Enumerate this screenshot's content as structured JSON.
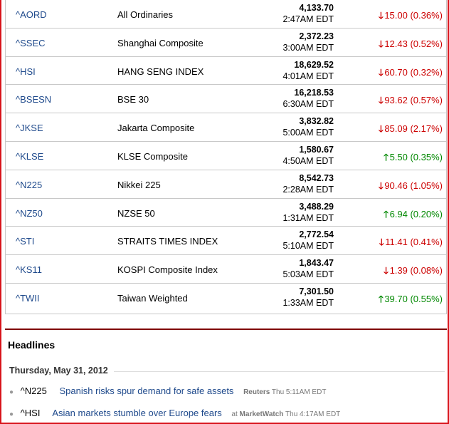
{
  "indices": [
    {
      "symbol": "^AORD",
      "name": "All Ordinaries",
      "price": "4,133.70",
      "time": "2:47AM EDT",
      "direction": "down",
      "change": "15.00 (0.36%)"
    },
    {
      "symbol": "^SSEC",
      "name": "Shanghai Composite",
      "price": "2,372.23",
      "time": "3:00AM EDT",
      "direction": "down",
      "change": "12.43 (0.52%)"
    },
    {
      "symbol": "^HSI",
      "name": "HANG SENG INDEX",
      "price": "18,629.52",
      "time": "4:01AM EDT",
      "direction": "down",
      "change": "60.70 (0.32%)"
    },
    {
      "symbol": "^BSESN",
      "name": "BSE 30",
      "price": "16,218.53",
      "time": "6:30AM EDT",
      "direction": "down",
      "change": "93.62 (0.57%)"
    },
    {
      "symbol": "^JKSE",
      "name": "Jakarta Composite",
      "price": "3,832.82",
      "time": "5:00AM EDT",
      "direction": "down",
      "change": "85.09 (2.17%)"
    },
    {
      "symbol": "^KLSE",
      "name": "KLSE Composite",
      "price": "1,580.67",
      "time": "4:50AM EDT",
      "direction": "up",
      "change": "5.50 (0.35%)"
    },
    {
      "symbol": "^N225",
      "name": "Nikkei 225",
      "price": "8,542.73",
      "time": "2:28AM EDT",
      "direction": "down",
      "change": "90.46 (1.05%)"
    },
    {
      "symbol": "^NZ50",
      "name": "NZSE 50",
      "price": "3,488.29",
      "time": "1:31AM EDT",
      "direction": "up",
      "change": "6.94 (0.20%)"
    },
    {
      "symbol": "^STI",
      "name": "STRAITS TIMES INDEX",
      "price": "2,772.54",
      "time": "5:10AM EDT",
      "direction": "down",
      "change": "11.41 (0.41%)"
    },
    {
      "symbol": "^KS11",
      "name": "KOSPI Composite Index",
      "price": "1,843.47",
      "time": "5:03AM EDT",
      "direction": "down",
      "change": "1.39 (0.08%)"
    },
    {
      "symbol": "^TWII",
      "name": "Taiwan Weighted",
      "price": "7,301.50",
      "time": "1:33AM EDT",
      "direction": "up",
      "change": "39.70 (0.55%)"
    }
  ],
  "arrows": {
    "up": "🡑",
    "down": "🡓"
  },
  "colors": {
    "up": "#008800",
    "down": "#cc0000",
    "link": "#1f4a8c",
    "frame": "#d8141b"
  },
  "headlines": {
    "title": "Headlines",
    "date": "Thursday, May 31, 2012",
    "items": [
      {
        "symbol": "^N225",
        "title": "Spanish risks spur demand for safe assets",
        "source_prefix": "",
        "source": "Reuters",
        "time": "Thu 5:11AM EDT"
      },
      {
        "symbol": "^HSI",
        "title": "Asian markets stumble over Europe fears",
        "source_prefix": "at",
        "source": "MarketWatch",
        "time": "Thu 4:17AM EDT"
      }
    ]
  }
}
